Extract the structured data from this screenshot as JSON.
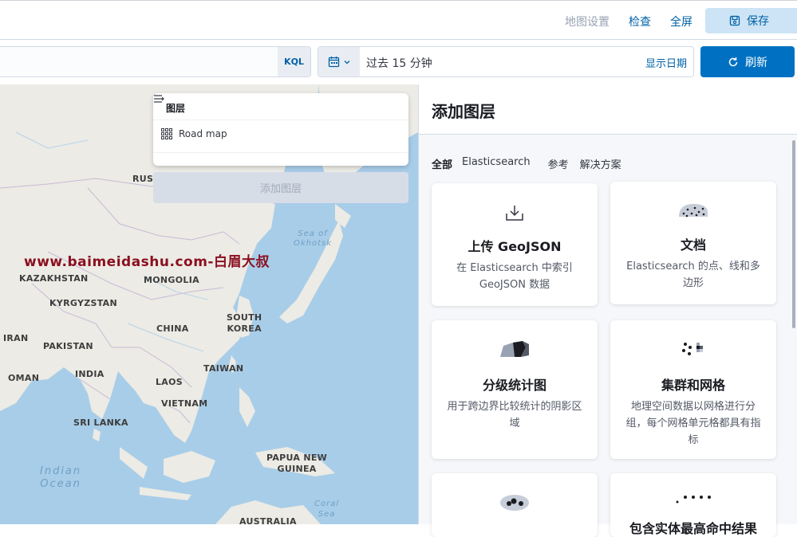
{
  "header": {
    "map_settings": "地图设置",
    "inspect": "检查",
    "fullscreen": "全屏",
    "save": "保存"
  },
  "querybar": {
    "language": "KQL",
    "time_range": "过去 15 分钟",
    "show_dates": "显示日期",
    "refresh": "刷新"
  },
  "map": {
    "labels": {
      "russia": "RUSS",
      "kazakhstan": "KAZAKHSTAN",
      "mongolia": "MONGOLIA",
      "kyrgyzstan": "KYRGYZSTAN",
      "china": "CHINA",
      "south_korea": "SOUTH\nKOREA",
      "iran": "IRAN",
      "pakistan": "PAKISTAN",
      "india": "INDIA",
      "oman": "OMAN",
      "taiwan": "TAIWAN",
      "laos": "LAOS",
      "vietnam": "VIETNAM",
      "sri_lanka": "SRI LANKA",
      "papua": "PAPUA NEW\nGUINEA",
      "australia": "AUSTRALIA",
      "sea_of_okhotsk": "Sea of\nOkhotsk",
      "indian_ocean": "Indian\nOcean",
      "coral_sea": "Coral\nSea"
    },
    "watermark": "www.baimeidashu.com-白眉大叔",
    "layers_panel": {
      "title": "图层",
      "items": [
        {
          "label": "Road map"
        }
      ],
      "add_layer": "添加图层"
    }
  },
  "panel": {
    "title": "添加图层",
    "filters": [
      "全部",
      "Elasticsearch",
      "参考",
      "解决方案"
    ],
    "cards": [
      {
        "title": "上传 GeoJSON",
        "desc": "在 Elasticsearch 中索引 GeoJSON 数据",
        "icon": "upload-icon"
      },
      {
        "title": "文档",
        "desc": "Elasticsearch 的点、线和多边形",
        "icon": "documents-icon"
      },
      {
        "title": "分级统计图",
        "desc": "用于跨边界比较统计的阴影区域",
        "icon": "choropleth-icon"
      },
      {
        "title": "集群和网格",
        "desc": "地理空间数据以网格进行分组，每个网格单元格都具有指标",
        "icon": "clusters-grid-icon"
      },
      {
        "title": "",
        "desc": "",
        "icon": "heatmap-icon"
      },
      {
        "title": "包含实体最高命中结果",
        "desc": "",
        "icon": "top-hits-icon"
      }
    ]
  },
  "colors": {
    "accent": "#0071c2",
    "link": "#0061a6",
    "watermark": "#8a1020",
    "annotation_arrow": "#f0843a"
  }
}
